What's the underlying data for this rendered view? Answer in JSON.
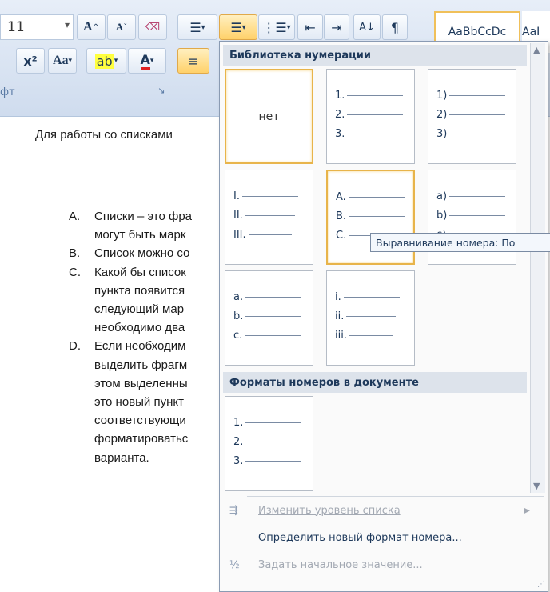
{
  "ribbon": {
    "font_size": "11",
    "grow_font": "A",
    "shrink_font": "A",
    "change_case": "Aa",
    "font_color_letter": "A",
    "group_label": "фт",
    "style_preview": "AaBbCcDc",
    "style_preview_next": "AaI"
  },
  "document": {
    "intro": "Для работы со списками",
    "items": [
      {
        "marker": "A.",
        "lines": [
          "Списки – это фра",
          "могут быть марк"
        ]
      },
      {
        "marker": "B.",
        "lines": [
          "Список можно со"
        ]
      },
      {
        "marker": "C.",
        "lines": [
          "Какой бы список",
          "пункта появится",
          "следующий мар",
          "необходимо два"
        ]
      },
      {
        "marker": "D.",
        "lines": [
          "Если необходим",
          "выделить фрагм",
          "этом выделенны",
          "это новый пункт",
          "соответствующи",
          "форматироватьс",
          "варианта."
        ]
      }
    ]
  },
  "gallery": {
    "library_header": "Библиотека нумерации",
    "none_label": "нет",
    "formats": [
      [
        "1.",
        "2.",
        "3."
      ],
      [
        "1)",
        "2)",
        "3)"
      ],
      [
        "I.",
        "II.",
        "III."
      ],
      [
        "A.",
        "B.",
        "C."
      ],
      [
        "a)",
        "b)",
        "c)"
      ],
      [
        "a.",
        "b.",
        "c."
      ],
      [
        "i.",
        "ii.",
        "iii."
      ]
    ],
    "doc_header": "Форматы номеров в документе",
    "doc_format": [
      "1.",
      "2.",
      "3."
    ],
    "tooltip": "Выравнивание номера: По"
  },
  "menu": {
    "change_level": "Изменить уровень списка",
    "define_new": "Определить новый формат номера...",
    "set_start": "Задать начальное значение..."
  }
}
